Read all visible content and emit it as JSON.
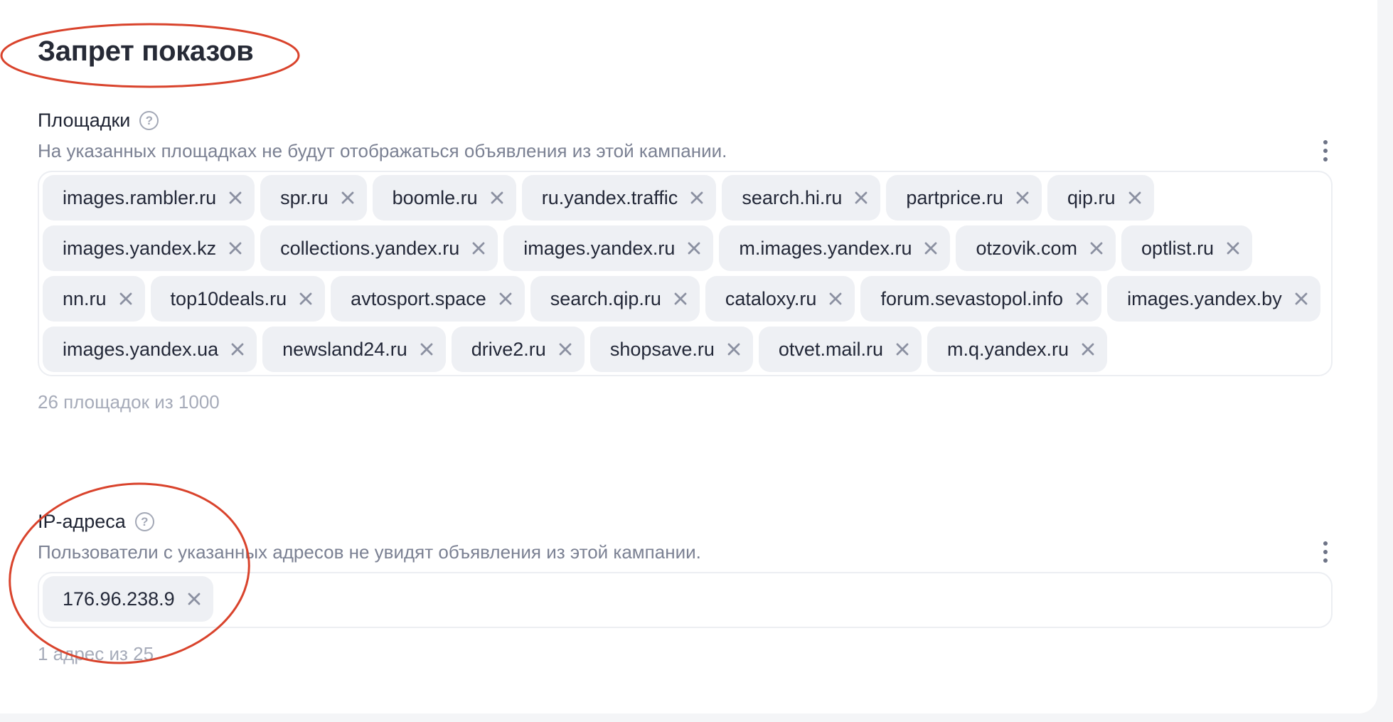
{
  "page": {
    "title": "Запрет показов"
  },
  "sites": {
    "label": "Площадки",
    "description": "На указанных площадках не будут отображаться объявления из этой кампании.",
    "tags": [
      "images.rambler.ru",
      "spr.ru",
      "boomle.ru",
      "ru.yandex.traffic",
      "search.hi.ru",
      "partprice.ru",
      "qip.ru",
      "images.yandex.kz",
      "collections.yandex.ru",
      "images.yandex.ru",
      "m.images.yandex.ru",
      "otzovik.com",
      "optlist.ru",
      "nn.ru",
      "top10deals.ru",
      "avtosport.space",
      "search.qip.ru",
      "cataloxy.ru",
      "forum.sevastopol.info",
      "images.yandex.by",
      "images.yandex.ua",
      "newsland24.ru",
      "drive2.ru",
      "shopsave.ru",
      "otvet.mail.ru",
      "m.q.yandex.ru"
    ],
    "counter": "26 площадок из 1000"
  },
  "ips": {
    "label": "IP-адреса",
    "description": "Пользователи с указанных адресов не увидят объявления из этой кампании.",
    "tags": [
      "176.96.238.9"
    ],
    "counter": "1 адрес из 25"
  },
  "icons": {
    "help": "help-circle-icon",
    "menu": "more-vertical-icon",
    "remove": "close-icon"
  },
  "colors": {
    "annotation": "#d9432c",
    "tag_background": "#eef0f4",
    "muted_text": "#7b8193"
  }
}
